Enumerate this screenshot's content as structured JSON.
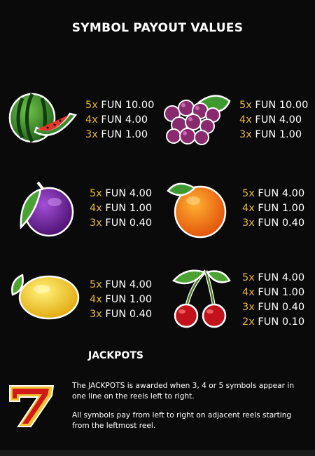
{
  "title": "SYMBOL PAYOUT VALUES",
  "symbols": [
    {
      "icon": "watermelon-icon",
      "payouts": [
        {
          "mult": "5x",
          "value": "FUN 10.00"
        },
        {
          "mult": "4x",
          "value": "FUN 4.00"
        },
        {
          "mult": "3x",
          "value": "FUN 1.00"
        }
      ]
    },
    {
      "icon": "grapes-icon",
      "payouts": [
        {
          "mult": "5x",
          "value": "FUN 10.00"
        },
        {
          "mult": "4x",
          "value": "FUN 4.00"
        },
        {
          "mult": "3x",
          "value": "FUN 1.00"
        }
      ]
    },
    {
      "icon": "plum-icon",
      "payouts": [
        {
          "mult": "5x",
          "value": "FUN 4.00"
        },
        {
          "mult": "4x",
          "value": "FUN 1.00"
        },
        {
          "mult": "3x",
          "value": "FUN 0.40"
        }
      ]
    },
    {
      "icon": "orange-icon",
      "payouts": [
        {
          "mult": "5x",
          "value": "FUN 4.00"
        },
        {
          "mult": "4x",
          "value": "FUN 1.00"
        },
        {
          "mult": "3x",
          "value": "FUN 0.40"
        }
      ]
    },
    {
      "icon": "lemon-icon",
      "payouts": [
        {
          "mult": "5x",
          "value": "FUN 4.00"
        },
        {
          "mult": "4x",
          "value": "FUN 1.00"
        },
        {
          "mult": "3x",
          "value": "FUN 0.40"
        }
      ]
    },
    {
      "icon": "cherries-icon",
      "payouts": [
        {
          "mult": "5x",
          "value": "FUN 4.00"
        },
        {
          "mult": "4x",
          "value": "FUN 1.00"
        },
        {
          "mult": "3x",
          "value": "FUN 0.40"
        },
        {
          "mult": "2x",
          "value": "FUN 0.10"
        }
      ]
    }
  ],
  "jackpots": {
    "title": "JACKPOTS",
    "icon": "seven-icon",
    "text1": "The JACKPOTS is awarded when 3, 4 or 5 symbols appear in one line on the reels left to right.",
    "text2": "All symbols pay from left to right on adjacent reels starting from the leftmost reel."
  },
  "colors": {
    "multiplier": "#e7b535",
    "background": "#0a0a0a",
    "text": "#ffffff"
  }
}
